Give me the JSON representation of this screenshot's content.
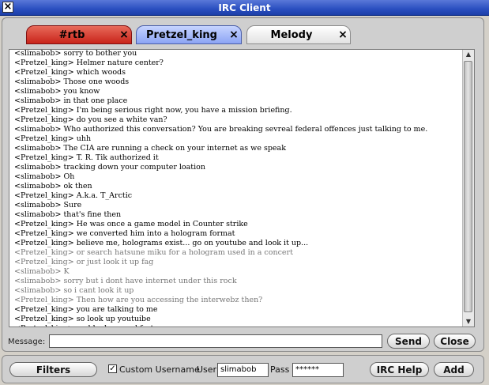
{
  "window": {
    "title": "IRC Client"
  },
  "tabs": [
    {
      "label": "#rtb",
      "close": "×"
    },
    {
      "label": "Pretzel_king",
      "close": "×"
    },
    {
      "label": "Melody",
      "close": "×"
    }
  ],
  "chat": {
    "lines": [
      "<slimabob> sorry to bother you",
      "<Pretzel_king> Helmer nature center?",
      "<Pretzel_king> which woods",
      "<slimabob> Those one woods",
      "<slimabob> you know",
      "<slimabob> in that one place",
      "<Pretzel_king> I'm being serious right now, you have a mission briefing.",
      "<Pretzel_king> do you see a white van?",
      "<slimabob> Who authorized this conversation? You are breaking sevreal federal offences just talking to me.",
      "<Pretzel_king> uhh",
      "<slimabob> The CIA are running a check on your internet as we speak",
      "<Pretzel_king> T. R. Tik authorized it",
      "<slimabob> tracking down your computer loation",
      "<slimabob> Oh",
      "<slimabob> ok then",
      "<Pretzel_king> A.k.a. T_Arctic",
      "<slimabob> Sure",
      "<slimabob> that's fine then",
      "<Pretzel_king> He was once a game model in Counter strike",
      "<Pretzel_king> we converted him into a hologram format",
      "<Pretzel_king> believe me, holograms exist... go on youtube and look it up...",
      "<Pretzel_king> or search hatsune miku for a hologram used in a concert",
      "<Pretzel_king> or just look it up fag",
      "<slimabob> K",
      "<slimabob> sorry but i dont have internet under this rock",
      "<slimabob> so i cant look it up",
      "<Pretzel_king> Then how are you accessing the interwebz then?",
      "<Pretzel_king> you are talking to me",
      "<Pretzel_king> so look up youtuibe",
      "<Pretzel_king> and look up and fart"
    ]
  },
  "compose": {
    "message_label": "Message:",
    "message_value": "",
    "send": "Send",
    "close": "Close"
  },
  "bottom": {
    "filters": "Filters",
    "custom_username": "Custom Username",
    "user_label": "User",
    "user_value": "slimabob",
    "pass_label": "Pass",
    "pass_value": "******",
    "irc_help": "IRC Help",
    "add": "Add"
  }
}
